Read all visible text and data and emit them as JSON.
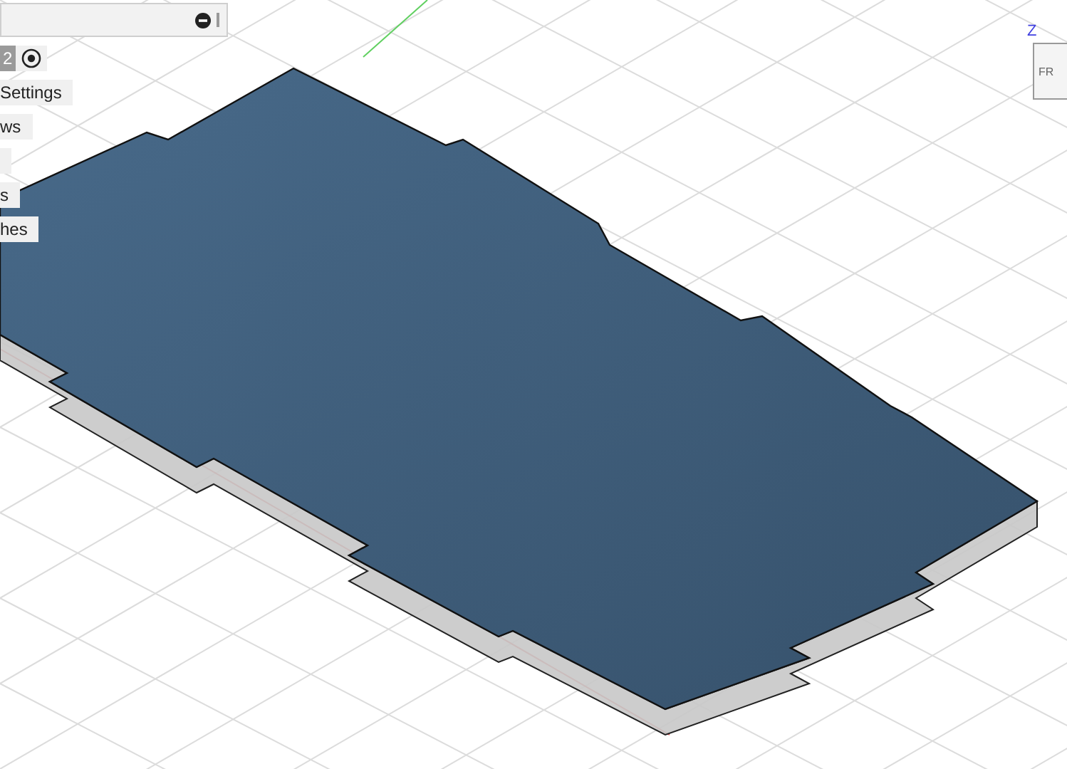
{
  "browser_panel": {
    "version_badge": "2",
    "items": [
      {
        "label": "Settings"
      },
      {
        "label": "ws"
      },
      {
        "label": "s"
      },
      {
        "label": "hes"
      }
    ]
  },
  "view_cube": {
    "axis_label": "Z",
    "face_label": "FR"
  }
}
